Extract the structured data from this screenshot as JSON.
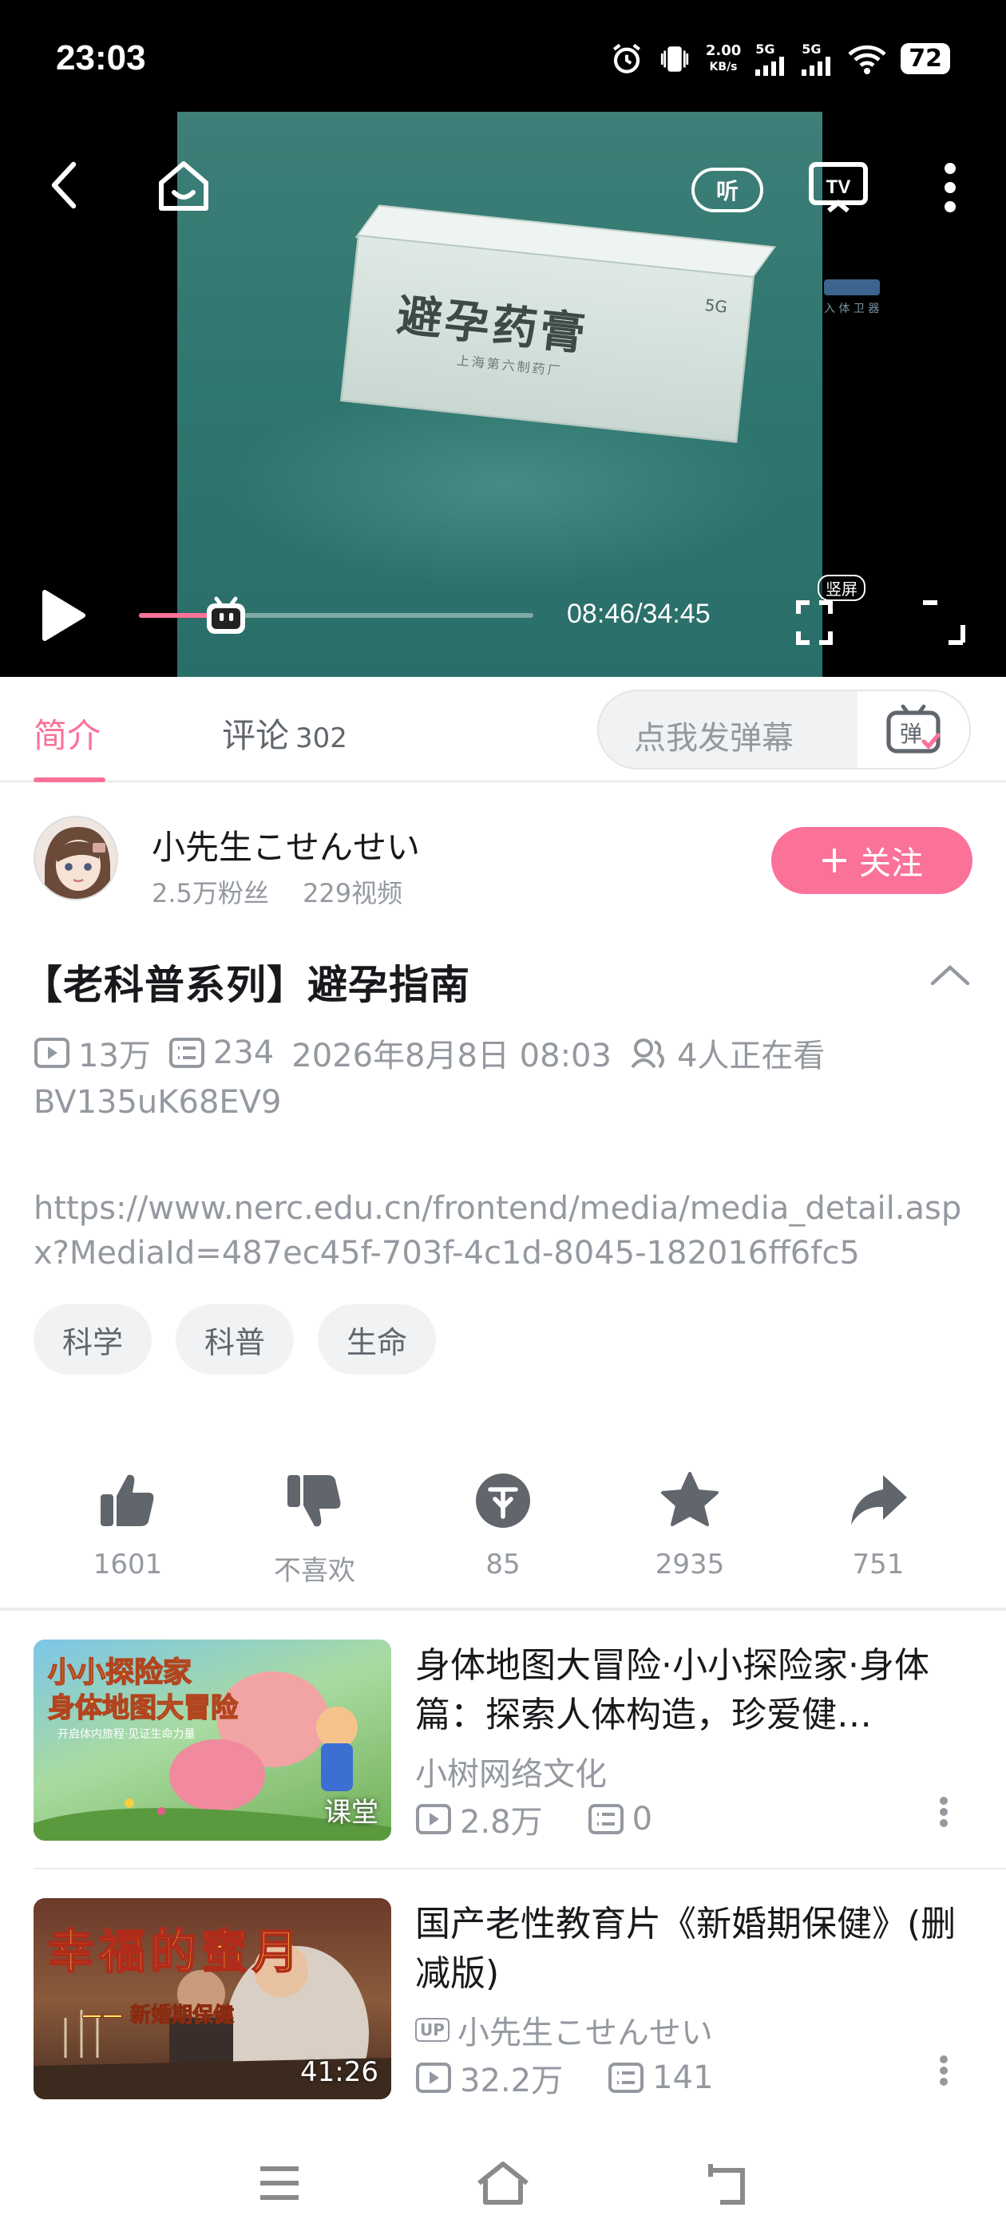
{
  "status_bar": {
    "time": "23:03",
    "net_speed_value": "2.00",
    "net_speed_unit": "KB/s",
    "net1": "5G",
    "net2": "5G",
    "battery": "72"
  },
  "player": {
    "listen_label": "听",
    "tv_label": "TV",
    "time_readout": "08:46/34:45",
    "vertical_label": "竖屏",
    "progress_fraction": 0.22,
    "box_label": "避孕药膏",
    "box_weight": "5G",
    "box_maker": "上海第六制药厂",
    "watermark_text": "入 体 卫 器"
  },
  "tabs": {
    "intro": "简介",
    "comments": "评论",
    "comment_count": "302",
    "danmaku_placeholder": "点我发弹幕",
    "danmaku_icon_text": "弹"
  },
  "uploader": {
    "name": "小先生こせんせい",
    "stats": "2.5万粉丝　 229视频",
    "follow_label": "关注"
  },
  "video": {
    "title": "【老科普系列】避孕指南",
    "views": "13万",
    "danmaku": "234",
    "date": "2026年8月8日 08:03",
    "watching": "4人正在看",
    "bvid": "BV135uK68EV9",
    "description": "https://www.nerc.edu.cn/frontend/media/media_detail.aspx?MediaId=487ec45f-703f-4c1d-8045-182016ff6fc5",
    "tags": [
      "科学",
      "科普",
      "生命"
    ]
  },
  "actions": {
    "like": "1601",
    "dislike": "不喜欢",
    "coin": "85",
    "favorite": "2935",
    "share": "751"
  },
  "related": [
    {
      "title": "身体地图大冒险·小小探险家·身体篇：探索人体构造，珍爱健…",
      "author": "小树网络文化",
      "views": "2.8万",
      "danmaku": "0",
      "badge": "课堂",
      "thumb_line1": "小小探险家",
      "thumb_line2": "身体地图大冒险",
      "thumb_line3": "开启体内旅程·见证生命力量"
    },
    {
      "title": "国产老性教育片《新婚期保健》(删减版)",
      "author": "小先生こせんせい",
      "author_tag": "UP",
      "views": "32.2万",
      "danmaku": "141",
      "badge": "41:26",
      "thumb_line1": "幸福的蜜月",
      "thumb_line2": "—— 新婚期保健"
    }
  ],
  "colors": {
    "accent": "#fb7299",
    "muted": "#9499a0",
    "video_bg": "#2f7770"
  }
}
